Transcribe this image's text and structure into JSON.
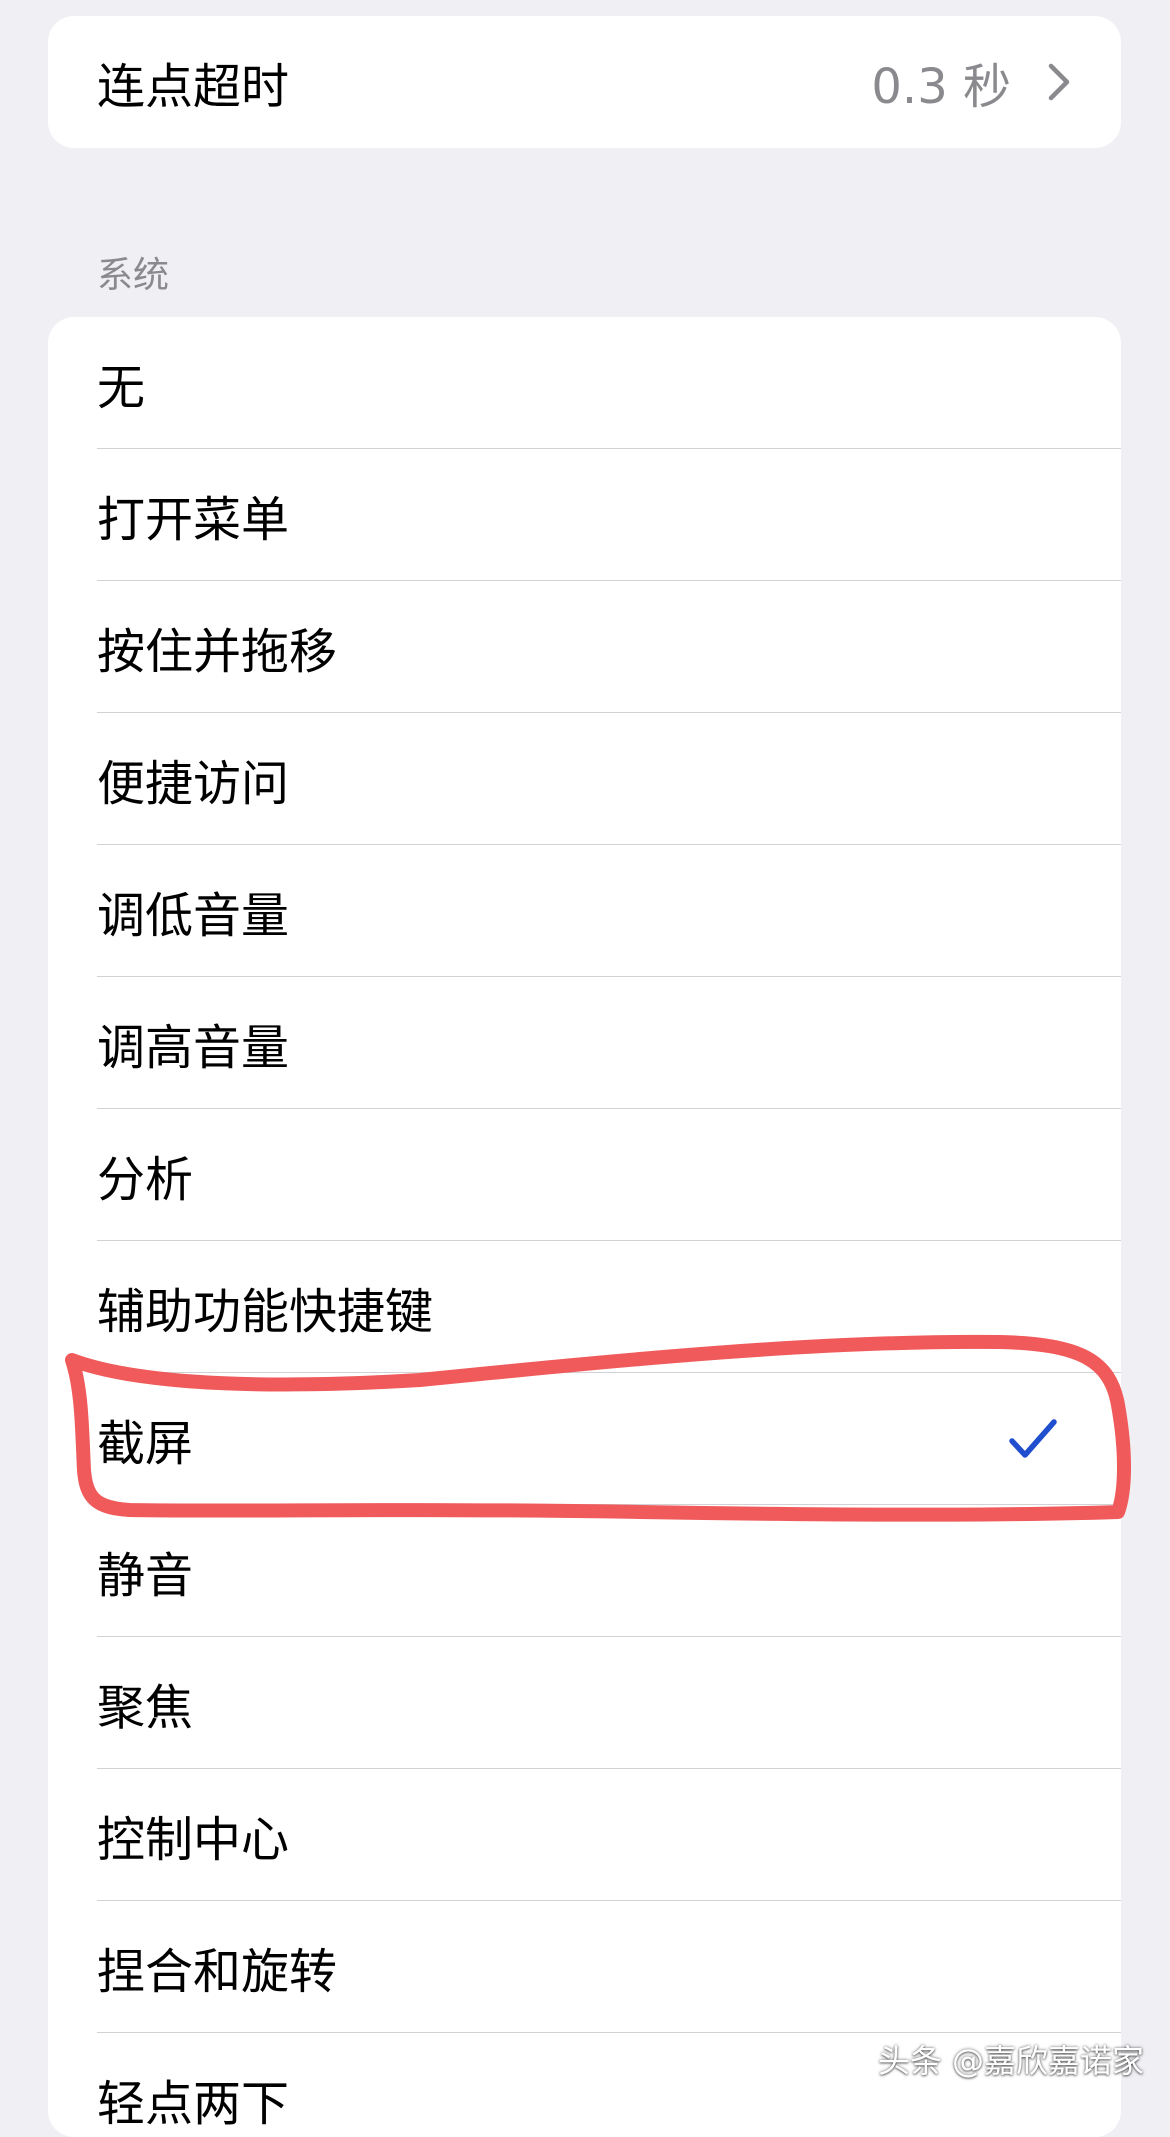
{
  "top_card": {
    "label": "连点超时",
    "value": "0.3 秒",
    "icon": "chevron-right-icon"
  },
  "section": {
    "header": "系统"
  },
  "list": {
    "items": [
      {
        "label": "无"
      },
      {
        "label": "打开菜单"
      },
      {
        "label": "按住并拖移"
      },
      {
        "label": "便捷访问"
      },
      {
        "label": "调低音量"
      },
      {
        "label": "调高音量"
      },
      {
        "label": "分析"
      },
      {
        "label": "辅助功能快捷键"
      },
      {
        "label": "截屏",
        "selected": true
      },
      {
        "label": "静音"
      },
      {
        "label": "聚焦"
      },
      {
        "label": "控制中心"
      },
      {
        "label": "捏合和旋转"
      },
      {
        "label": "轻点两下"
      }
    ]
  },
  "colors": {
    "background": "#EFEFF4",
    "checkmark": "#1F4FCF",
    "annotation": "#F05A5A",
    "secondary_text": "#8A8A8E"
  },
  "watermark": "头条 @嘉欣嘉诺家"
}
